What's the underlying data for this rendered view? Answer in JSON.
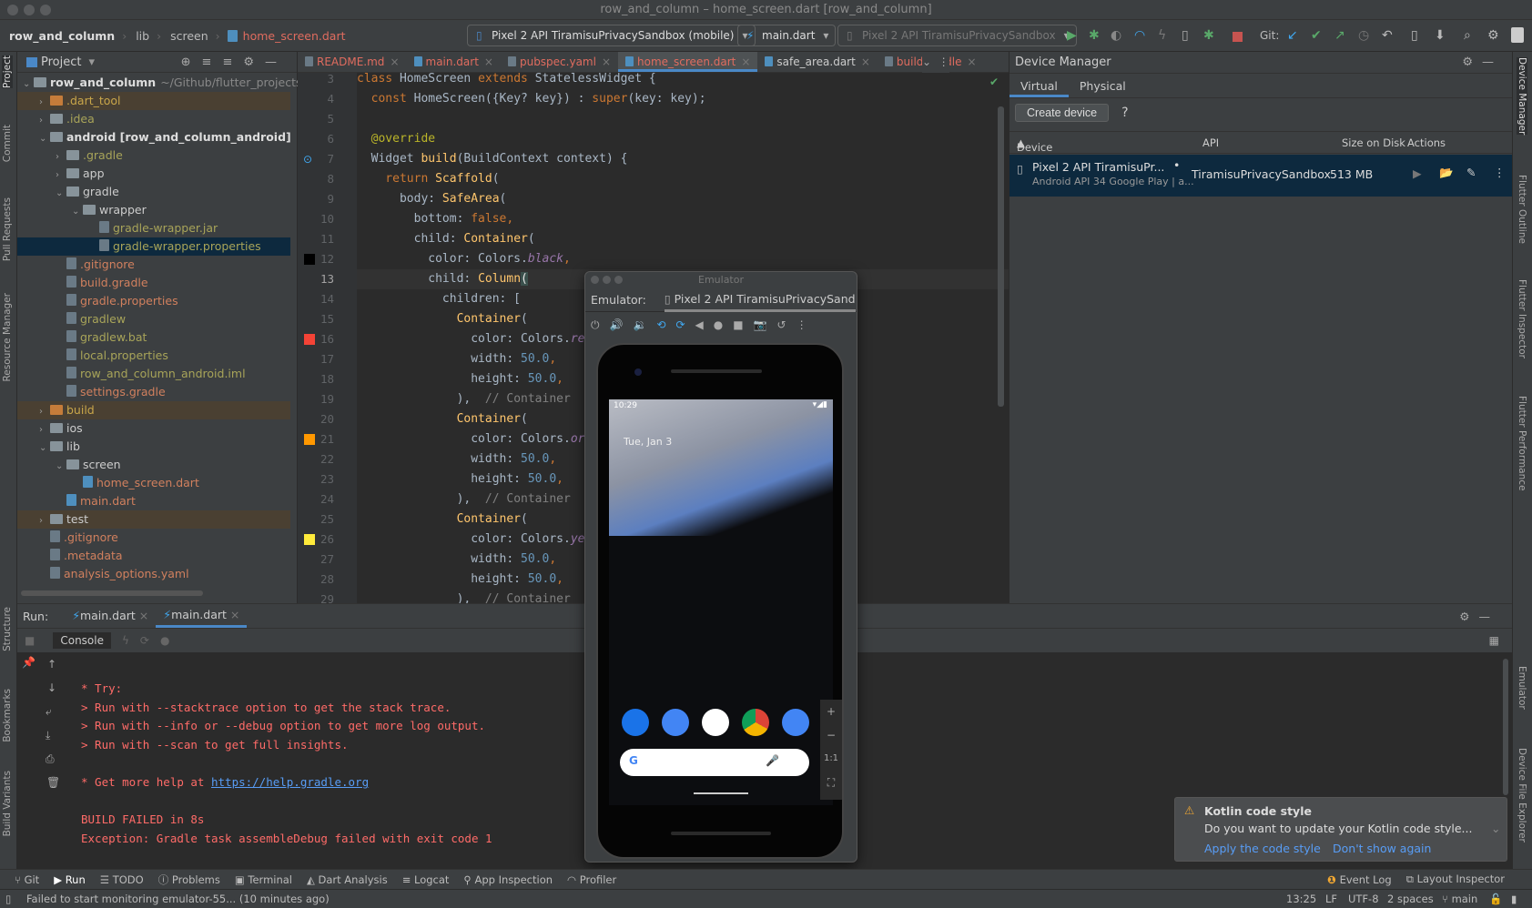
{
  "window": {
    "title": "row_and_column – home_screen.dart [row_and_column]"
  },
  "nav": {
    "breadcrumbs": [
      "row_and_column",
      "lib",
      "screen",
      "home_screen.dart"
    ],
    "device_selector": "Pixel 2 API TiramisuPrivacySandbox (mobile)",
    "run_config": "main.dart",
    "device_disabled": "Pixel 2 API TiramisuPrivacySandbox",
    "git_label": "Git:"
  },
  "left_stripe": [
    "Project",
    "Commit",
    "Pull Requests",
    "Resource Manager",
    "Structure",
    "Bookmarks",
    "Build Variants"
  ],
  "right_stripe": [
    "Device Manager",
    "Flutter Outline",
    "Flutter Inspector",
    "Flutter Performance",
    "Emulator",
    "Device File Explorer"
  ],
  "project": {
    "title": "Project",
    "tree": [
      {
        "label": "row_and_column",
        "suffix": "~/Github/flutter_projects",
        "level": 0,
        "open": true,
        "type": "folder",
        "color": "#dddddd",
        "bold": true
      },
      {
        "label": ".dart_tool",
        "level": 1,
        "open": false,
        "type": "folder-o",
        "color": "#c9a64a",
        "bg": "excl"
      },
      {
        "label": ".idea",
        "level": 1,
        "open": false,
        "type": "folder",
        "color": "#a8a459"
      },
      {
        "label": "android [row_and_column_android]",
        "level": 1,
        "open": true,
        "type": "folder",
        "color": "#dddddd",
        "bold": true
      },
      {
        "label": ".gradle",
        "level": 2,
        "open": false,
        "type": "folder",
        "color": "#a8a459"
      },
      {
        "label": "app",
        "level": 2,
        "open": false,
        "type": "folder",
        "color": "#cccccc"
      },
      {
        "label": "gradle",
        "level": 2,
        "open": true,
        "type": "folder",
        "color": "#cccccc"
      },
      {
        "label": "wrapper",
        "level": 3,
        "open": true,
        "type": "folder",
        "color": "#cccccc"
      },
      {
        "label": "gradle-wrapper.jar",
        "level": 4,
        "type": "file",
        "color": "#a8a459"
      },
      {
        "label": "gradle-wrapper.properties",
        "level": 4,
        "type": "file",
        "color": "#a8a459",
        "bg": "sel"
      },
      {
        "label": ".gitignore",
        "level": 2,
        "type": "file",
        "color": "#d1805e"
      },
      {
        "label": "build.gradle",
        "level": 2,
        "type": "file",
        "color": "#d1805e"
      },
      {
        "label": "gradle.properties",
        "level": 2,
        "type": "file",
        "color": "#d1805e"
      },
      {
        "label": "gradlew",
        "level": 2,
        "type": "file",
        "color": "#a8a459"
      },
      {
        "label": "gradlew.bat",
        "level": 2,
        "type": "file",
        "color": "#a8a459"
      },
      {
        "label": "local.properties",
        "level": 2,
        "type": "file",
        "color": "#a8a459"
      },
      {
        "label": "row_and_column_android.iml",
        "level": 2,
        "type": "file",
        "color": "#a8a459"
      },
      {
        "label": "settings.gradle",
        "level": 2,
        "type": "file",
        "color": "#d1805e"
      },
      {
        "label": "build",
        "level": 1,
        "open": false,
        "type": "folder-o",
        "color": "#c9a64a",
        "bg": "excl"
      },
      {
        "label": "ios",
        "level": 1,
        "open": false,
        "type": "folder",
        "color": "#cccccc"
      },
      {
        "label": "lib",
        "level": 1,
        "open": true,
        "type": "folder",
        "color": "#cccccc"
      },
      {
        "label": "screen",
        "level": 2,
        "open": true,
        "type": "folder",
        "color": "#cccccc"
      },
      {
        "label": "home_screen.dart",
        "level": 3,
        "type": "dart",
        "color": "#d1805e"
      },
      {
        "label": "main.dart",
        "level": 2,
        "type": "dart",
        "color": "#d1805e"
      },
      {
        "label": "test",
        "level": 1,
        "open": false,
        "type": "folder",
        "color": "#cccccc",
        "bg": "excl"
      },
      {
        "label": ".gitignore",
        "level": 1,
        "type": "file",
        "color": "#d1805e"
      },
      {
        "label": ".metadata",
        "level": 1,
        "type": "file",
        "color": "#d1805e"
      },
      {
        "label": "analysis_options.yaml",
        "level": 1,
        "type": "file",
        "color": "#d1805e"
      }
    ]
  },
  "editor": {
    "tabs": [
      {
        "label": "README.md"
      },
      {
        "label": "main.dart"
      },
      {
        "label": "pubspec.yaml"
      },
      {
        "label": "home_screen.dart",
        "active": true
      },
      {
        "label": "safe_area.dart",
        "white": true
      },
      {
        "label": "build.gradle"
      }
    ],
    "current_line": 13,
    "swatches": {
      "12": "#000000",
      "16": "#f44336",
      "21": "#ff9800",
      "26": "#ffeb3b"
    },
    "lines": [
      {
        "n": 3,
        "t": [
          [
            "class ",
            "kw"
          ],
          [
            "HomeScreen ",
            ""
          ],
          [
            "extends ",
            "kw"
          ],
          [
            "StatelessWidget {",
            ""
          ]
        ]
      },
      {
        "n": 4,
        "t": [
          [
            "  const ",
            "kw"
          ],
          [
            "HomeScreen({Key? key}) : ",
            ""
          ],
          [
            "super",
            "kw"
          ],
          [
            "(key: key);",
            ""
          ]
        ]
      },
      {
        "n": 5,
        "t": []
      },
      {
        "n": 6,
        "t": [
          [
            "  @override",
            "an"
          ]
        ]
      },
      {
        "n": 7,
        "t": [
          [
            "  Widget ",
            ""
          ],
          [
            "build",
            "fn"
          ],
          [
            "(BuildContext context) {",
            ""
          ]
        ]
      },
      {
        "n": 8,
        "t": [
          [
            "    return ",
            "kw"
          ],
          [
            "Scaffold",
            "fn"
          ],
          [
            "(",
            ""
          ]
        ]
      },
      {
        "n": 9,
        "t": [
          [
            "      body: ",
            ""
          ],
          [
            "SafeArea",
            "fn"
          ],
          [
            "(",
            ""
          ]
        ]
      },
      {
        "n": 10,
        "t": [
          [
            "        bottom: ",
            ""
          ],
          [
            "false",
            "kw"
          ],
          [
            ",",
            "kw"
          ]
        ]
      },
      {
        "n": 11,
        "t": [
          [
            "        child: ",
            ""
          ],
          [
            "Container",
            "fn"
          ],
          [
            "(",
            ""
          ]
        ]
      },
      {
        "n": 12,
        "t": [
          [
            "          color: Colors.",
            ""
          ],
          [
            "black",
            "it"
          ],
          [
            ",",
            "kw"
          ]
        ]
      },
      {
        "n": 13,
        "t": [
          [
            "          child: ",
            ""
          ],
          [
            "Column",
            "fn"
          ],
          [
            "(",
            "br"
          ]
        ]
      },
      {
        "n": 14,
        "t": [
          [
            "            children: [",
            ""
          ]
        ]
      },
      {
        "n": 15,
        "t": [
          [
            "              Container",
            "fn"
          ],
          [
            "(",
            ""
          ]
        ]
      },
      {
        "n": 16,
        "t": [
          [
            "                color: Colors.",
            ""
          ],
          [
            "red",
            "it"
          ],
          [
            ",",
            "kw"
          ]
        ]
      },
      {
        "n": 17,
        "t": [
          [
            "                width: ",
            ""
          ],
          [
            "50.0",
            "num"
          ],
          [
            ",",
            "kw"
          ]
        ]
      },
      {
        "n": 18,
        "t": [
          [
            "                height: ",
            ""
          ],
          [
            "50.0",
            "num"
          ],
          [
            ",",
            "kw"
          ]
        ]
      },
      {
        "n": 19,
        "t": [
          [
            "              ),  ",
            ""
          ],
          [
            "// Container",
            "cm"
          ]
        ]
      },
      {
        "n": 20,
        "t": [
          [
            "              Container",
            "fn"
          ],
          [
            "(",
            ""
          ]
        ]
      },
      {
        "n": 21,
        "t": [
          [
            "                color: Colors.",
            ""
          ],
          [
            "orange",
            "it"
          ],
          [
            ",",
            "kw"
          ]
        ]
      },
      {
        "n": 22,
        "t": [
          [
            "                width: ",
            ""
          ],
          [
            "50.0",
            "num"
          ],
          [
            ",",
            "kw"
          ]
        ]
      },
      {
        "n": 23,
        "t": [
          [
            "                height: ",
            ""
          ],
          [
            "50.0",
            "num"
          ],
          [
            ",",
            "kw"
          ]
        ]
      },
      {
        "n": 24,
        "t": [
          [
            "              ),  ",
            ""
          ],
          [
            "// Container",
            "cm"
          ]
        ]
      },
      {
        "n": 25,
        "t": [
          [
            "              Container",
            "fn"
          ],
          [
            "(",
            ""
          ]
        ]
      },
      {
        "n": 26,
        "t": [
          [
            "                color: Colors.",
            ""
          ],
          [
            "yellow",
            "it"
          ],
          [
            ",",
            "kw"
          ]
        ]
      },
      {
        "n": 27,
        "t": [
          [
            "                width: ",
            ""
          ],
          [
            "50.0",
            "num"
          ],
          [
            ",",
            "kw"
          ]
        ]
      },
      {
        "n": 28,
        "t": [
          [
            "                height: ",
            ""
          ],
          [
            "50.0",
            "num"
          ],
          [
            ",",
            "kw"
          ]
        ]
      },
      {
        "n": 29,
        "t": [
          [
            "              ),  ",
            ""
          ],
          [
            "// Container",
            "cm"
          ]
        ]
      }
    ]
  },
  "device_manager": {
    "title": "Device Manager",
    "tabs": [
      "Virtual",
      "Physical"
    ],
    "create_button": "Create device",
    "help": "?",
    "columns": [
      "Device",
      "API",
      "Size on Disk",
      "Actions"
    ],
    "devices": [
      {
        "name": "Pixel 2 API TiramisuPr...",
        "detail": "Android API 34 Google Play | a...",
        "api": "TiramisuPrivacySandbox",
        "size": "513 MB"
      }
    ]
  },
  "run": {
    "label": "Run:",
    "tabs": [
      "main.dart",
      "main.dart"
    ],
    "console_tab": "Console",
    "lines": [
      {
        "text": "* Try:"
      },
      {
        "text": "> Run with --stacktrace option to get the stack trace."
      },
      {
        "text": "> Run with --info or --debug option to get more log output."
      },
      {
        "text": "> Run with --scan to get full insights."
      },
      {
        "text": ""
      },
      {
        "text": "* Get more help at ",
        "link": "https://help.gradle.org"
      },
      {
        "text": ""
      },
      {
        "text": "BUILD FAILED in 8s"
      },
      {
        "text": "Exception: Gradle task assembleDebug failed with exit code 1"
      }
    ]
  },
  "emulator": {
    "window_title": "Emulator",
    "label": "Emulator:",
    "device_tab": "Pixel 2 API TiramisuPrivacySand",
    "clock": "10:29",
    "date": "Tue, Jan 3",
    "zoom_ratio": "1:1"
  },
  "notification": {
    "title": "Kotlin code style",
    "body": "Do you want to update your Kotlin code style...",
    "action1": "Apply the code style",
    "action2": "Don't show again"
  },
  "bottom_tools": [
    "Git",
    "Run",
    "TODO",
    "Problems",
    "Terminal",
    "Dart Analysis",
    "Logcat",
    "App Inspection",
    "Profiler"
  ],
  "bottom_right_tools": [
    "Event Log",
    "Layout Inspector"
  ],
  "status": {
    "message": "Failed to start monitoring emulator-55... (10 minutes ago)",
    "position": "13:25",
    "line_sep": "LF",
    "encoding": "UTF-8",
    "indent": "2 spaces",
    "branch": "main"
  },
  "colors": {
    "accent": "#4a88c7",
    "error": "#ff6b68",
    "selection": "#0d293e"
  }
}
